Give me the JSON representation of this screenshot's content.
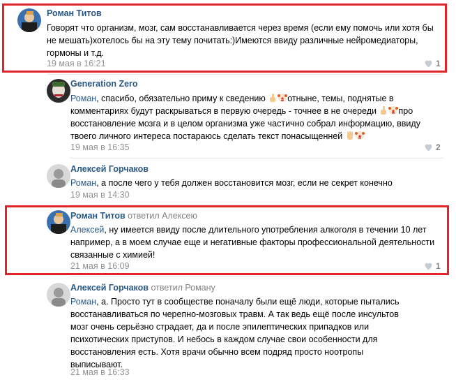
{
  "comments": [
    {
      "author": "Роман Титов",
      "reply_to": "",
      "text": "Говорят что организм, мозг, сам восстанавливается через время (если ему помочь или хотя бы не мешать)хотелось бы на эту тему почитать:)Имеются ввиду различные нейромедиаторы, гормоны и т.д.",
      "date": "19 мая в 16:21",
      "likes": "1"
    },
    {
      "author": "Generation Zero",
      "reply_to": "",
      "mention": "Роман",
      "text_1": ", спасибо, обязательно приму к сведению",
      "text_2": "отныне, темы, поднятые в комментариях будут раскрываться в первую очередь - точнее в не очереди",
      "text_3": "про восстановление мозга и в целом организма уже частично собрал информацию, ввиду твоего личного интереса постараюсь сделать текст понасыщенней",
      "date": "19 мая в 16:35",
      "likes": "2"
    },
    {
      "author": "Алексей Горчаков",
      "reply_to": "",
      "mention": "Роман",
      "text": ", а после чего у тебя должен восстановится мозг, если не секрет конечно",
      "date": "19 мая в 14:30",
      "likes": ""
    },
    {
      "author": "Роман Титов",
      "reply_to": "ответил Алексею",
      "mention": "Алексей",
      "text": ", ну имеется ввиду после длительного употребления алкоголя в течении 10 лет например, а в моем случае еще и негативные факторы профессиональной деятельности связанные с химией!",
      "date": "21 мая в 16:09",
      "likes": "1"
    },
    {
      "author": "Алексей Горчаков",
      "reply_to": "ответил Роману",
      "mention": "Роман",
      "text": ", а. Просто тут в сообществе поначалу были ещё люди, которые пытались восстанавливаться по черепно-мозговых травм. А так ведь ещё после инсультов мозг очень серьёзно страдает, да и после эпилептических припадков или психотических приступов. И небось в каждом случае свои особенности для восстановления есть. Хотя врачи обычно всем подряд просто ноотропы выписывают.",
      "date": "21 мая в 16:33",
      "likes": ""
    }
  ],
  "colors": {
    "link": "#2a5885",
    "highlight": "#e4222a",
    "meta": "#939393"
  },
  "icons": {
    "like": "heart-icon",
    "emoji_finger": "pointing-finger-emoji",
    "emoji_clown": "clown-face-emoji",
    "emoji_hand": "raised-hand-emoji"
  }
}
